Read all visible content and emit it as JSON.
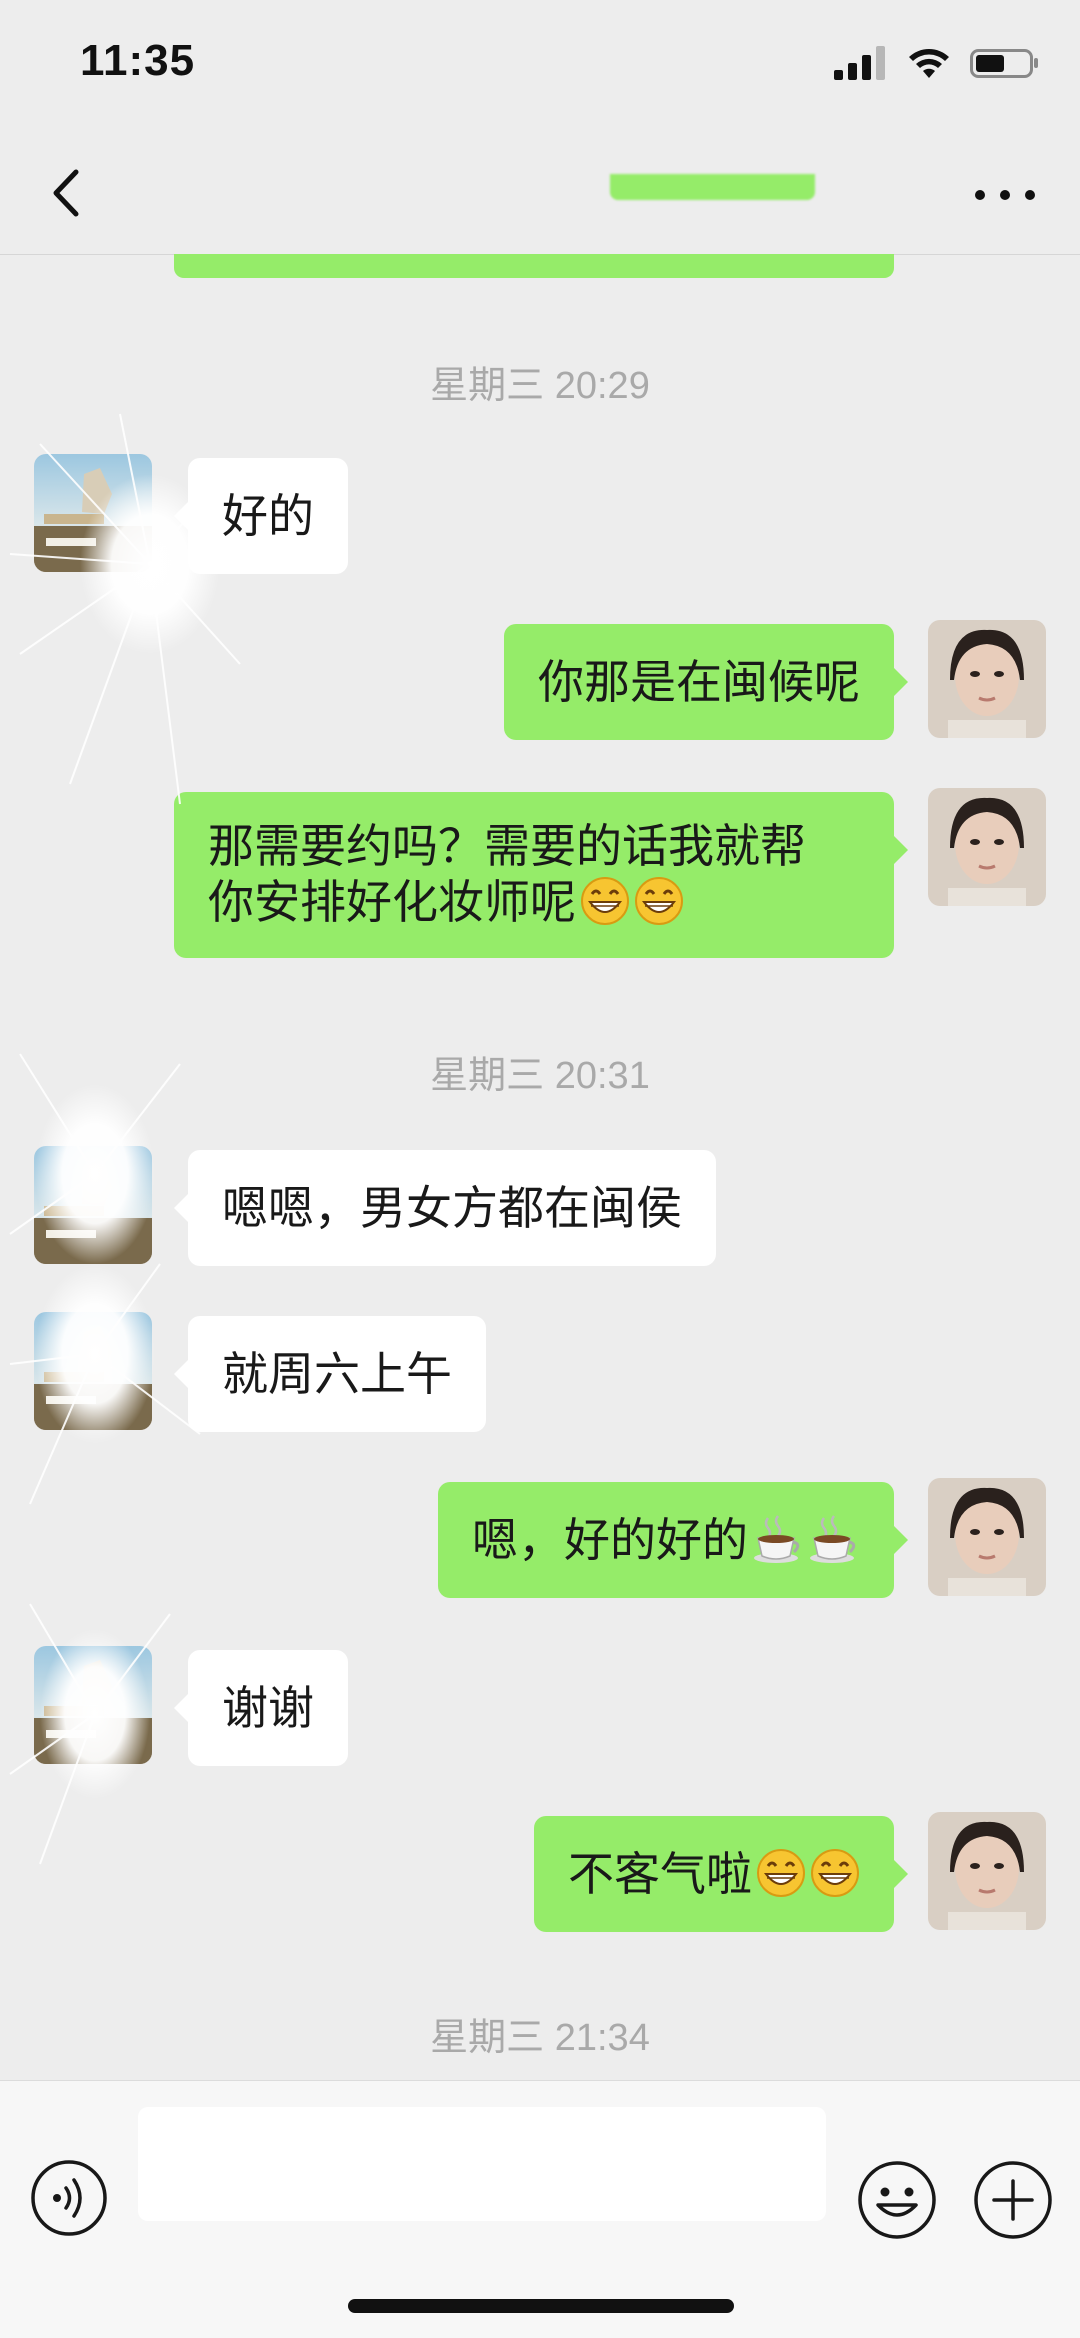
{
  "status_bar": {
    "time": "11:35"
  },
  "nav": {
    "back_icon": "chevron-left-icon",
    "more_icon": "more-horizontal-icon"
  },
  "messages": [
    {
      "type": "timestamp",
      "text": "星期三 20:29"
    },
    {
      "type": "in",
      "lines": [
        "好的"
      ]
    },
    {
      "type": "out",
      "lines": [
        "你那是在闽候呢"
      ]
    },
    {
      "type": "out",
      "lines": [
        "那需要约吗？需要的话我就帮",
        "你安排好化妆师呢😁😁"
      ]
    },
    {
      "type": "timestamp",
      "text": "星期三 20:31"
    },
    {
      "type": "in",
      "lines": [
        "嗯嗯，男女方都在闽侯"
      ]
    },
    {
      "type": "in",
      "lines": [
        "就周六上午"
      ]
    },
    {
      "type": "out",
      "lines": [
        "嗯，好的好的☕☕"
      ]
    },
    {
      "type": "in",
      "lines": [
        "谢谢"
      ]
    },
    {
      "type": "out",
      "lines": [
        "不客气啦😁😁"
      ]
    },
    {
      "type": "timestamp",
      "text": "星期三 21:34"
    }
  ],
  "text": {
    "ts1": "星期三 20:29",
    "m1": "好的",
    "m2": "你那是在闽候呢",
    "m3a": "那需要约吗？需要的话我就帮",
    "m3b": "你安排好化妆师呢",
    "ts2": "星期三 20:31",
    "m4": "嗯嗯，男女方都在闽侯",
    "m5": "就周六上午",
    "m6": "嗯，好的好的",
    "m7": "谢谢",
    "m8": "不客气啦",
    "ts3": "星期三 21:34"
  },
  "input_bar": {
    "input_value": "",
    "voice_icon": "voice-icon",
    "emoji_icon": "emoji-icon",
    "plus_icon": "plus-circle-icon"
  },
  "colors": {
    "background": "#ededed",
    "outgoing_bubble": "#95ec69",
    "incoming_bubble": "#ffffff",
    "timestamp": "#a9a9a9"
  }
}
